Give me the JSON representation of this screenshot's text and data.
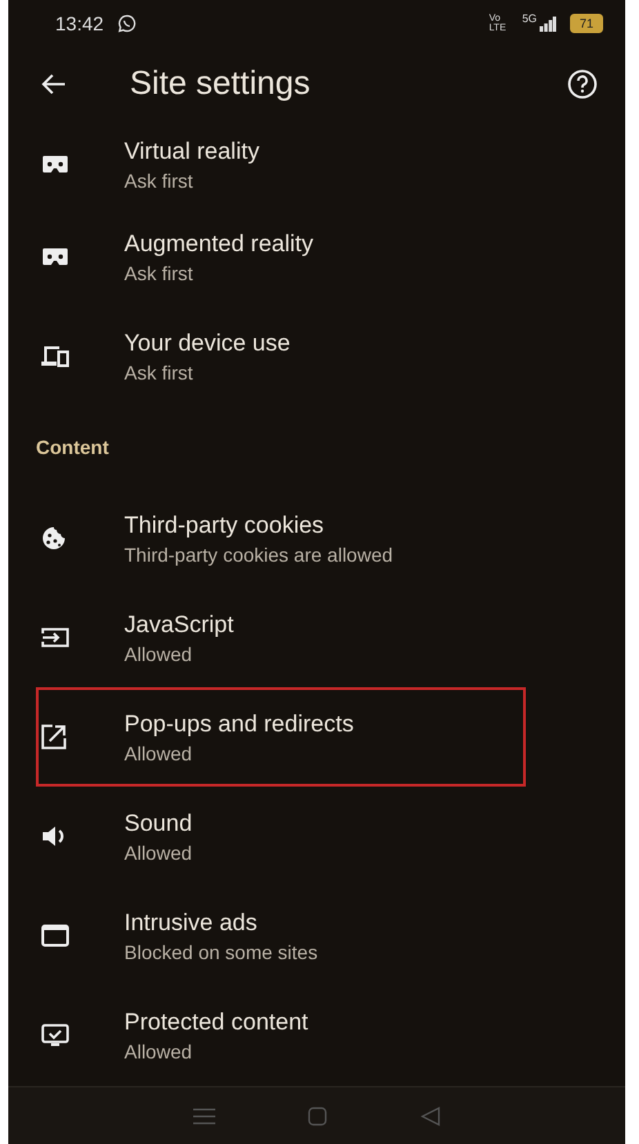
{
  "status_bar": {
    "time": "13:42",
    "volte": "Vo LTE",
    "network": "5G",
    "battery": "71"
  },
  "header": {
    "title": "Site settings"
  },
  "sections": [
    {
      "items": [
        {
          "kind": "vr",
          "title": "Virtual reality",
          "subtitle": "Ask first",
          "highlighted": false
        },
        {
          "kind": "vr",
          "title": "Augmented reality",
          "subtitle": "Ask first",
          "highlighted": false
        },
        {
          "kind": "devices",
          "title": "Your device use",
          "subtitle": "Ask first",
          "highlighted": false
        }
      ]
    },
    {
      "title": "Content",
      "items": [
        {
          "kind": "cookie",
          "title": "Third-party cookies",
          "subtitle": "Third-party cookies are allowed",
          "highlighted": false
        },
        {
          "kind": "code",
          "title": "JavaScript",
          "subtitle": "Allowed",
          "highlighted": false
        },
        {
          "kind": "external",
          "title": "Pop-ups and redirects",
          "subtitle": "Allowed",
          "highlighted": true
        },
        {
          "kind": "sound",
          "title": "Sound",
          "subtitle": "Allowed",
          "highlighted": false
        },
        {
          "kind": "window",
          "title": "Intrusive ads",
          "subtitle": "Blocked on some sites",
          "highlighted": false
        },
        {
          "kind": "protected",
          "title": "Protected content",
          "subtitle": "Allowed",
          "highlighted": false
        }
      ]
    }
  ]
}
